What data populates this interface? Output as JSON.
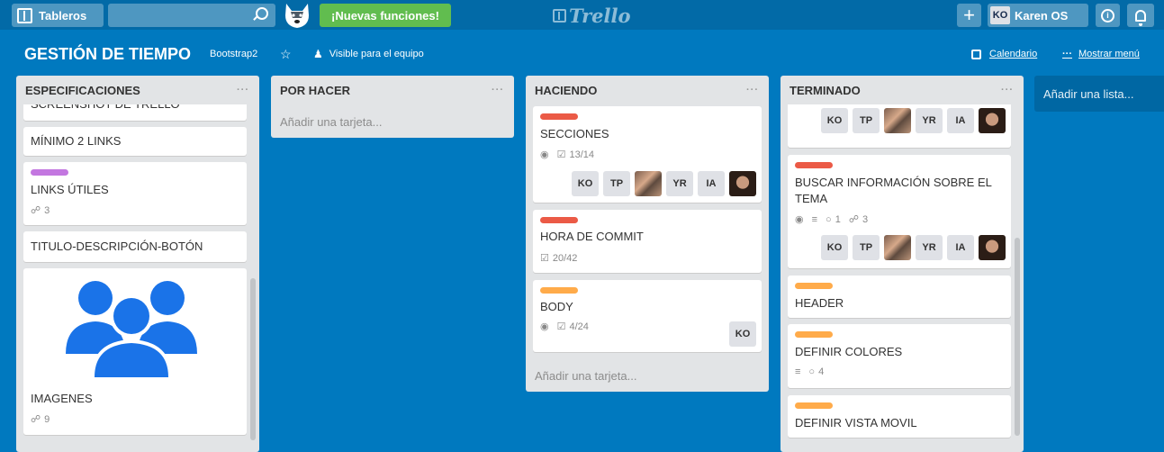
{
  "topbar": {
    "boards_label": "Tableros",
    "search_value": "",
    "news_label": "¡Nuevas funciones!",
    "logo": "Trello",
    "plus_label": "+",
    "user_initials": "KO",
    "user_name": "Karen OS",
    "info_label": "i"
  },
  "board": {
    "title": "GESTIÓN DE TIEMPO",
    "team": "Bootstrap2",
    "star": "☆",
    "visibility": "Visible para el equipo",
    "calendar": "Calendario",
    "menu_dots": "···",
    "menu": "Mostrar menú",
    "add_list": "Añadir una lista..."
  },
  "colors": {
    "green": "#61bd4f",
    "purple": "#c377e0",
    "red": "#eb5a46",
    "orange": "#ffab4a",
    "board_bg": "#0079bf"
  },
  "icons": [
    "boards-icon",
    "search-icon",
    "husky-icon",
    "trello-logo-icon",
    "plus-icon",
    "info-icon",
    "bell-icon",
    "star-icon",
    "team-icon",
    "calendar-icon",
    "eye-icon",
    "checklist-icon",
    "attachment-icon",
    "description-icon",
    "comment-icon",
    "group-icon"
  ],
  "lists": [
    {
      "name": "ESPECIFICACIONES",
      "menu": "···",
      "cards": [
        {
          "title": "SCREENSHOT DE TRELLO"
        },
        {
          "title": "MÍNIMO 2 LINKS"
        },
        {
          "label": "purple",
          "title": "LINKS ÚTILES",
          "attachments": "3"
        },
        {
          "title": "TITULO-DESCRIPCIÓN-BOTÓN"
        },
        {
          "title": "IMAGENES",
          "cover": "group-icon",
          "attachments": "9"
        }
      ]
    },
    {
      "name": "POR HACER",
      "menu": "···",
      "add_card": "Añadir una tarjeta..."
    },
    {
      "name": "HACIENDO",
      "menu": "···",
      "cards": [
        {
          "label": "red",
          "title": "SECCIONES",
          "checklist": "13/14",
          "members": [
            "KO",
            "TP",
            "photo",
            "YR",
            "IA",
            "photo"
          ]
        },
        {
          "label": "red",
          "title": "HORA DE COMMIT",
          "checklist": "20/42"
        },
        {
          "label": "orange",
          "title": "BODY",
          "checklist": "4/24",
          "members": [
            "KO"
          ]
        }
      ],
      "add_card": "Añadir una tarjeta..."
    },
    {
      "name": "TERMINADO",
      "menu": "···",
      "cards": [
        {
          "label": "green",
          "members": [
            "KO",
            "TP",
            "photo",
            "YR",
            "IA",
            "photo"
          ]
        },
        {
          "label": "red",
          "title": "BUSCAR INFORMACIÓN SOBRE EL TEMA",
          "comments": "1",
          "attachments": "3",
          "members": [
            "KO",
            "TP",
            "photo",
            "YR",
            "IA",
            "photo"
          ]
        },
        {
          "label": "orange",
          "title": "HEADER"
        },
        {
          "label": "orange",
          "title": "DEFINIR COLORES",
          "comments": "4"
        },
        {
          "label": "orange",
          "title": "DEFINIR VISTA MOVIL"
        }
      ]
    }
  ]
}
